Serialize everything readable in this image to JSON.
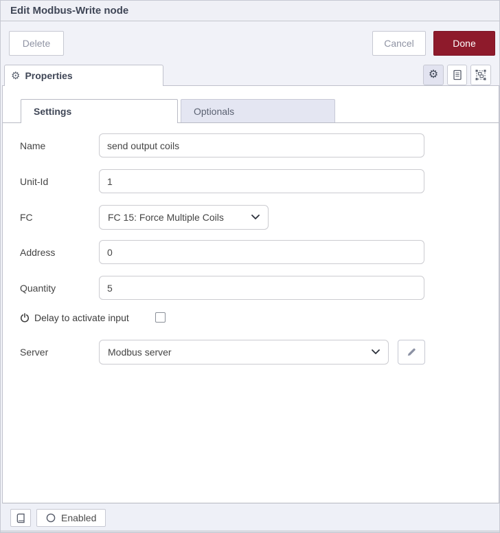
{
  "dialog": {
    "title": "Edit Modbus-Write node",
    "toolbar": {
      "delete_label": "Delete",
      "cancel_label": "Cancel",
      "done_label": "Done"
    },
    "editor_tabs": {
      "properties_label": "Properties"
    },
    "inner_tabs": {
      "settings_label": "Settings",
      "optionals_label": "Optionals"
    },
    "form": {
      "name": {
        "label": "Name",
        "value": "send output coils"
      },
      "unit_id": {
        "label": "Unit-Id",
        "value": "1"
      },
      "fc": {
        "label": "FC",
        "value": "FC 15: Force Multiple Coils"
      },
      "address": {
        "label": "Address",
        "value": "0"
      },
      "quantity": {
        "label": "Quantity",
        "value": "5"
      },
      "delay": {
        "label": "Delay to activate input",
        "checked": false
      },
      "server": {
        "label": "Server",
        "value": "Modbus server"
      }
    },
    "footer": {
      "enabled_label": "Enabled"
    }
  },
  "glyphs": {
    "gear": "⚙"
  },
  "icons": {
    "properties_tab": "gear-icon",
    "toolbar_right": [
      "gear-icon",
      "document-icon",
      "object-group-icon"
    ],
    "delay_label": "power-icon",
    "server_edit": "pencil-icon",
    "selects": "chevron-down-icon",
    "footer": [
      "book-icon",
      "circle-outline-icon"
    ]
  },
  "colors": {
    "accent_done": "#8e1a2b",
    "panel_bg": "#f1f2f8",
    "inactive_tab_bg": "#e4e6f2",
    "content_bg": "#ffffff",
    "title_text": "#3f4656"
  }
}
